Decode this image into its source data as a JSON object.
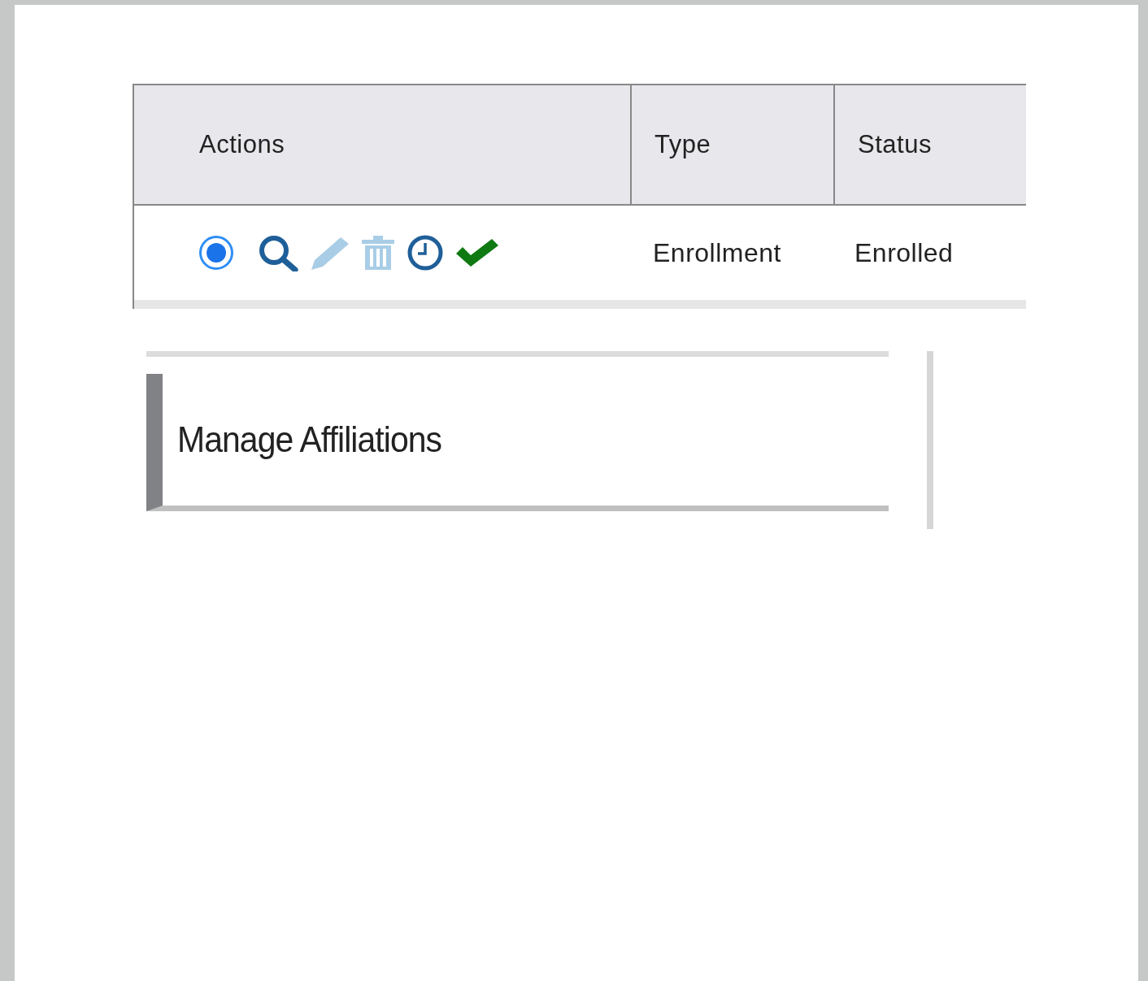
{
  "table": {
    "columns": [
      "Actions",
      "Type",
      "Status"
    ],
    "rows": [
      {
        "selected": true,
        "type": "Enrollment",
        "status": "Enrolled",
        "actions": [
          {
            "kind": "view",
            "disabled": false
          },
          {
            "kind": "edit",
            "disabled": true
          },
          {
            "kind": "delete",
            "disabled": true
          },
          {
            "kind": "history",
            "disabled": false
          },
          {
            "kind": "approve",
            "disabled": false
          }
        ]
      }
    ]
  },
  "panel": {
    "title": "Manage Affiliations"
  }
}
